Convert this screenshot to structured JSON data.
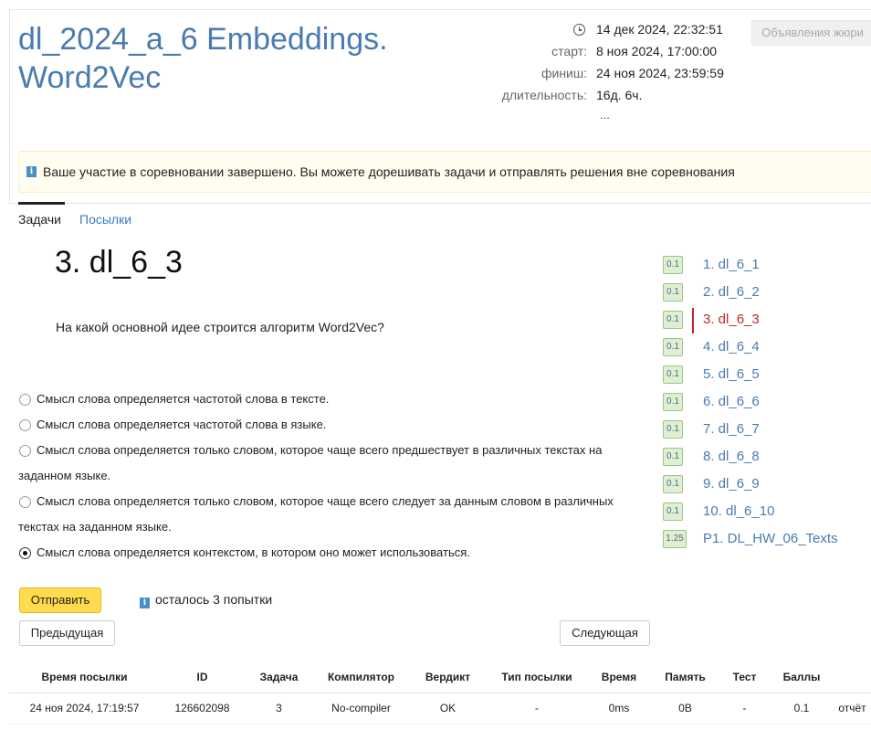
{
  "contest": {
    "title": "dl_2024_a_6 Embeddings. Word2Vec",
    "now": "14 дек 2024, 22:32:51",
    "start_label": "старт:",
    "start": "8 ноя 2024, 17:00:00",
    "finish_label": "финиш:",
    "finish": "24 ноя 2024, 23:59:59",
    "duration_label": "длительность:",
    "duration": "16д. 6ч.",
    "ellipsis": "...",
    "jury_button": "Объявления жюри"
  },
  "notice": {
    "icon": "info-icon",
    "text": "Ваше участие в соревновании завершено. Вы можете дорешивать задачи и отправлять решения вне соревнования"
  },
  "tabs": [
    {
      "label": "Задачи",
      "active": true
    },
    {
      "label": "Посылки",
      "active": false
    }
  ],
  "problem": {
    "title": "3. dl_6_3",
    "question": "На какой основной идее строится алгоритм Word2Vec?",
    "options": [
      {
        "line1": "Смысл слова определяется частотой слова в тексте.",
        "line2": "",
        "checked": false
      },
      {
        "line1": "Смысл слова определяется частотой слова в языке.",
        "line2": "",
        "checked": false
      },
      {
        "line1": "Смысл слова определяется только словом, которое чаще всего предшествует в различных текстах на",
        "line2": "заданном языке.",
        "checked": false
      },
      {
        "line1": "Смысл слова определяется только словом, которое чаще всего следует за данным словом в различных",
        "line2": "текстах на заданном языке.",
        "checked": false
      },
      {
        "line1": "Смысл слова определяется контекстом, в котором оно может использоваться.",
        "line2": "",
        "checked": true
      }
    ],
    "submit_button": "Отправить",
    "attempts": "осталось 3 попытки",
    "prev_button": "Предыдущая",
    "next_button": "Следующая"
  },
  "problem_list": [
    {
      "score": "0.1",
      "name": "1. dl_6_1",
      "current": false
    },
    {
      "score": "0.1",
      "name": "2. dl_6_2",
      "current": false
    },
    {
      "score": "0.1",
      "name": "3. dl_6_3",
      "current": true
    },
    {
      "score": "0.1",
      "name": "4. dl_6_4",
      "current": false
    },
    {
      "score": "0.1",
      "name": "5. dl_6_5",
      "current": false
    },
    {
      "score": "0.1",
      "name": "6. dl_6_6",
      "current": false
    },
    {
      "score": "0.1",
      "name": "7. dl_6_7",
      "current": false
    },
    {
      "score": "0.1",
      "name": "8. dl_6_8",
      "current": false
    },
    {
      "score": "0.1",
      "name": "9. dl_6_9",
      "current": false
    },
    {
      "score": "0.1",
      "name": "10. dl_6_10",
      "current": false
    },
    {
      "score": "1.25",
      "name": "P1. DL_HW_06_Texts",
      "current": false
    }
  ],
  "submissions": {
    "headers": [
      "Время посылки",
      "ID",
      "Задача",
      "Компилятор",
      "Вердикт",
      "Тип посылки",
      "Время",
      "Память",
      "Тест",
      "Баллы",
      ""
    ],
    "rows": [
      [
        "24 ноя 2024, 17:19:57",
        "126602098",
        "3",
        "No-compiler",
        "OK",
        "-",
        "0ms",
        "0B",
        "-",
        "0.1",
        "отчёт"
      ]
    ]
  },
  "colors": {
    "title": "#4a7bb0",
    "link": "#3a7bc8",
    "current": "#c0282d",
    "submit": "#ffdb4d",
    "badge_bg": "#dff0d2",
    "ok": "#2e9a2e",
    "notice_bg": "#fffdf0"
  }
}
